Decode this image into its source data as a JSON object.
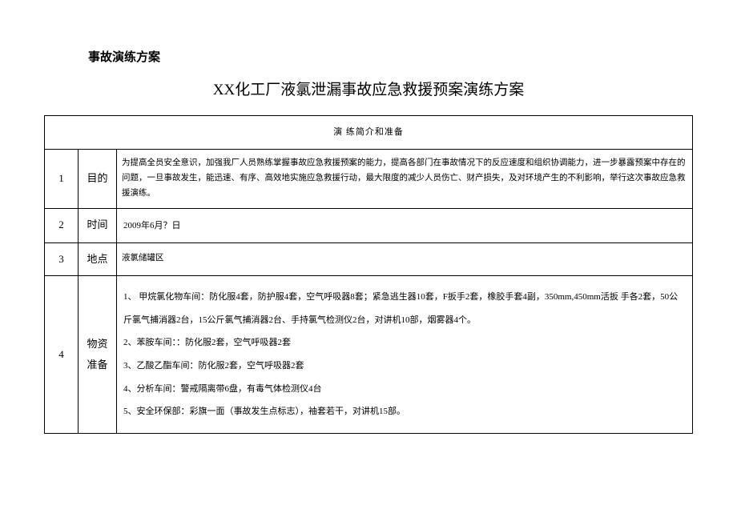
{
  "header_title": "事故演练方案",
  "main_title": "XX化工厂液氯泄漏事故应急救援预案演练方案",
  "section_header": "演 练简介和准备",
  "rows": [
    {
      "num": "1",
      "label": "目的",
      "content": "为提高全员安全意识，加强我厂人员熟练掌握事故应急救援预案的能力，提高各部门在事故情况下的反应速度和组织协调能力，进一步暴露预案中存在的问题，一旦事故发生，能迅速、有序、高效地实施应急救援行动，最大限度的减少人员伤亡、财产损失，及对环境产生的不利影响，举行这次事故应急救援演练。"
    },
    {
      "num": "2",
      "label": "时间",
      "content": "2009年6月？日"
    },
    {
      "num": "3",
      "label": "地点",
      "content": "液氯储罐区"
    },
    {
      "num": "4",
      "label": "物资准备",
      "content_lines": {
        "line1": "1、 甲烷氯化物车间：防化服4套，防护服4套，空气呼吸器8套；紧急逃生器10套，F扳手2套，橡胶手套4副，350mm,450mm活扳 手各2套，50公斤氯气捕消器2台，15公斤氯气捕消器2台、手持氯气检测仪2台，对讲机10部，烟雾器4个。",
        "line2": "2、苯胺车间：：防化服2套，空气呼吸器2套",
        "line3": "3、乙酸乙酯车间：防化服2套，空气呼吸器2套",
        "line4": "4、分析车间：警戒隔离带6盘，有毒气体检测仪4台",
        "line5": "5、安全环保部：彩旗一面（事故发生点标志），袖套若干，对讲机15部。"
      }
    }
  ]
}
